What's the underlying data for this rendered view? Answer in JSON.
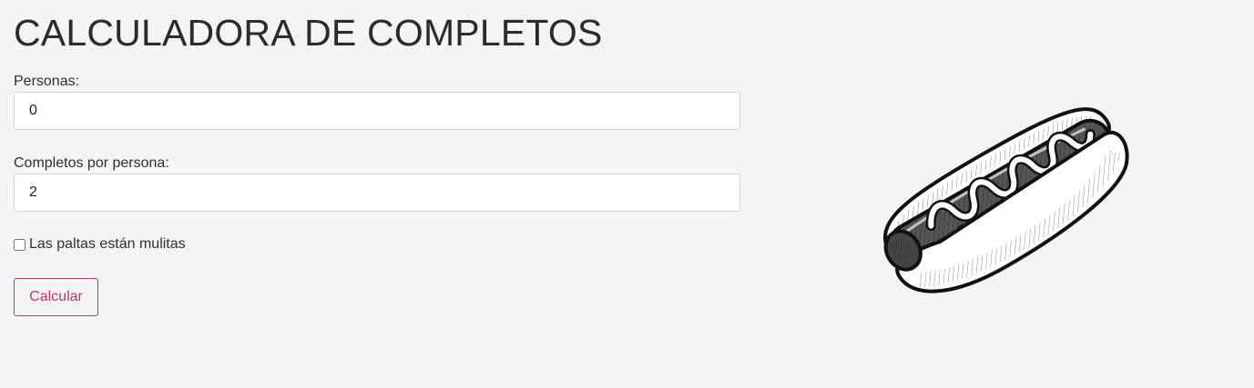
{
  "header": {
    "title": "CALCULADORA DE COMPLETOS"
  },
  "form": {
    "personas": {
      "label": "Personas:",
      "value": "0"
    },
    "completos_por_persona": {
      "label": "Completos por persona:",
      "value": "2"
    },
    "paltas_checkbox": {
      "label": "Las paltas están mulitas",
      "checked": false
    },
    "submit_label": "Calcular"
  },
  "illustration": {
    "icon": "hotdog-illustration"
  },
  "colors": {
    "background": "#f4f4f6",
    "accent": "#b83a6a",
    "text": "#2b2b2b"
  }
}
